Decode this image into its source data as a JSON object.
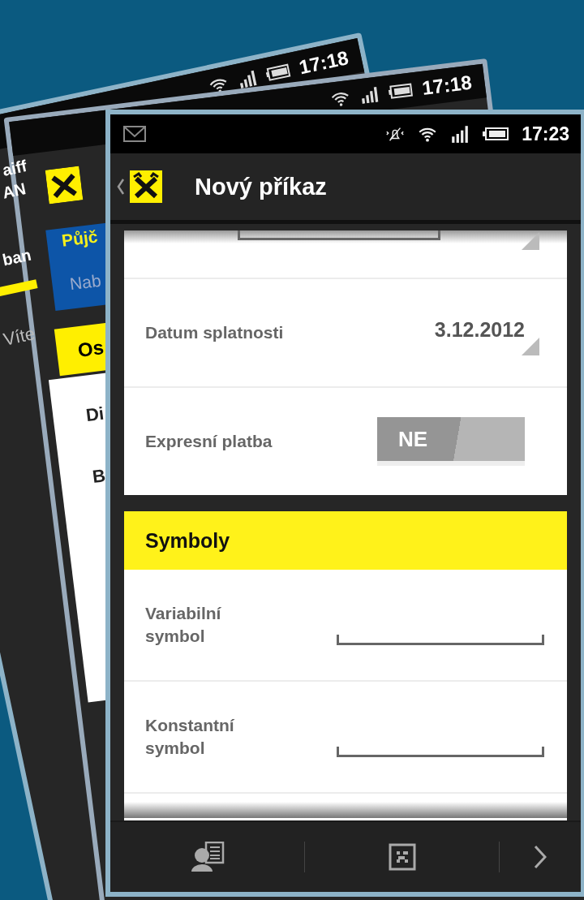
{
  "back_screens": [
    {
      "time": "17:18",
      "texts": [
        "aiff",
        "AN",
        "ban",
        "Víte"
      ]
    },
    {
      "time": "17:18",
      "texts": [
        "Půjč",
        "Nab",
        "Os",
        "Di",
        "B"
      ]
    }
  ],
  "status_bar": {
    "time": "17:23"
  },
  "app_bar": {
    "title": "Nový příkaz"
  },
  "payment_rows": [
    {
      "kind": "date",
      "label": "Datum splatnosti",
      "value": "3.12.2012"
    },
    {
      "kind": "toggle",
      "label": "Expresní platba",
      "on": false,
      "text": "NE"
    }
  ],
  "symbols": {
    "title": "Symboly",
    "rows": [
      {
        "label": "Variabilní symbol"
      },
      {
        "label": "Konstantní symbol"
      }
    ]
  }
}
